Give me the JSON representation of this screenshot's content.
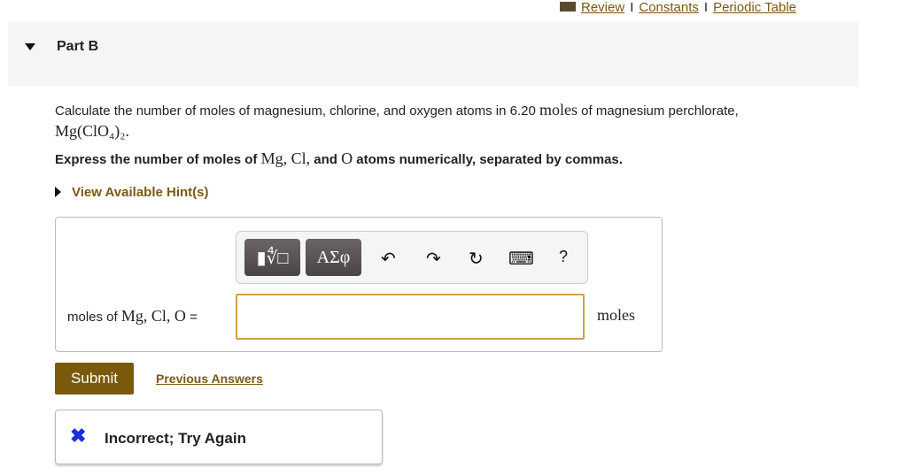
{
  "top_links": {
    "review": "Review",
    "constants": "Constants",
    "periodic_table": "Periodic Table",
    "sep": "I"
  },
  "part": {
    "title": "Part B"
  },
  "question": {
    "text": "Calculate the number of moles of magnesium, chlorine, and oxygen atoms in 6.20",
    "moles": "moles",
    "text2": "of magnesium perchlorate,",
    "formula": "Mg(ClO₄)₂."
  },
  "instruction": {
    "a": "Express the number of moles of",
    "vars": "Mg, Cl,",
    "b": "and",
    "o": "O",
    "c": "atoms numerically, separated by commas."
  },
  "hint": {
    "label": "View Available Hint(s)"
  },
  "toolbar": {
    "templates": "▮∜□",
    "greek": "ΑΣφ",
    "undo": "↶",
    "redo": "↷",
    "reset": "↻",
    "keyboard": "⌨",
    "help": "?"
  },
  "answer": {
    "label_text": "moles of",
    "label_vars": "Mg, Cl, O",
    "eq": "=",
    "value": "",
    "unit": "moles"
  },
  "buttons": {
    "submit": "Submit",
    "previous": "Previous Answers"
  },
  "feedback": {
    "icon": "✖",
    "text": "Incorrect; Try Again"
  }
}
